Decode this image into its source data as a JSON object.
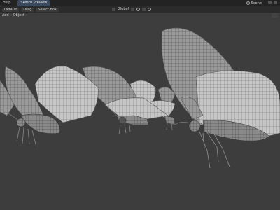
{
  "topbar": {
    "menu_label": "Help",
    "active_tab": "Sketch Preview",
    "scene_label": "Scene"
  },
  "header": {
    "mode_label": "Default",
    "drag_label": "Drag",
    "select_label": "Select Box",
    "transform_label": "Global"
  },
  "menubar": {
    "items": [
      "Add",
      "Object"
    ]
  }
}
